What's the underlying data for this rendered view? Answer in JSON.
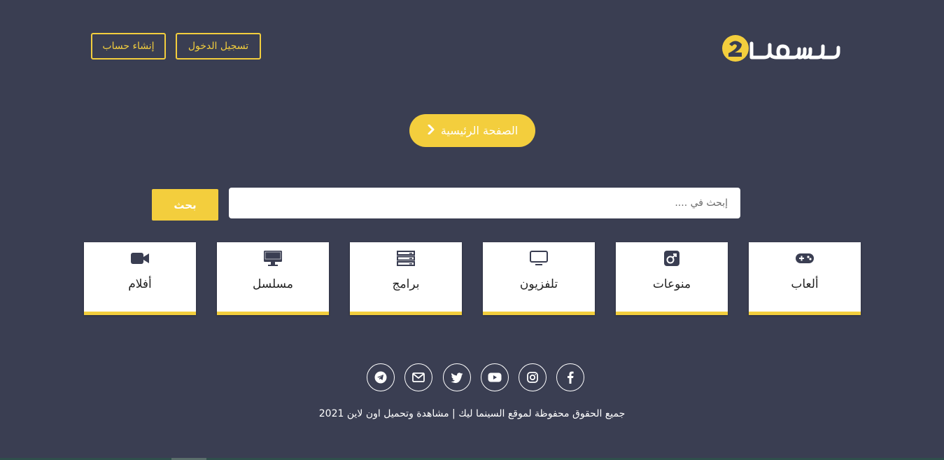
{
  "header": {
    "logo_text": "سيماز",
    "login_label": "تسجيل الدخول",
    "register_label": "إنشاء حساب"
  },
  "home_button": {
    "label": "الصفحة الرئيسية",
    "icon": "chevron-right-icon"
  },
  "search": {
    "placeholder": "إبحث في ....",
    "value": "",
    "button_label": "بحث"
  },
  "categories": [
    {
      "label": "ألعاب",
      "icon": "gamepad-icon"
    },
    {
      "label": "منوعات",
      "icon": "mars-icon"
    },
    {
      "label": "تلفزيون",
      "icon": "tv-icon"
    },
    {
      "label": "برامج",
      "icon": "server-icon"
    },
    {
      "label": "مسلسل",
      "icon": "desktop-icon"
    },
    {
      "label": "أفلام",
      "icon": "video-camera-icon"
    }
  ],
  "social": [
    "facebook-icon",
    "instagram-icon",
    "youtube-icon",
    "twitter-icon",
    "envelope-icon",
    "telegram-icon"
  ],
  "footer": {
    "copyright": "جميع الحقوق محفوظة لموقع السينما ليك | مشاهدة وتحميل اون لاين 2021"
  },
  "colors": {
    "background": "#3a3e52",
    "accent": "#f3ce3d",
    "card": "#ffffff",
    "icon": "#3a3e52"
  }
}
